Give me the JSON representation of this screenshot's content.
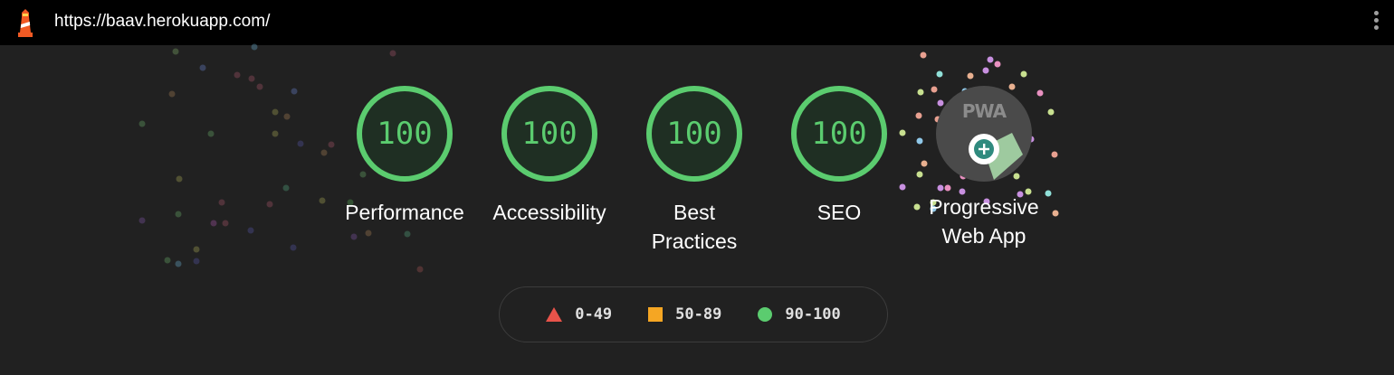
{
  "browser": {
    "url": "https://baav.herokuapp.com/",
    "logo_icon": "lighthouse-icon",
    "menu_icon": "vertical-dots-icon"
  },
  "gauges": [
    {
      "score": "100",
      "label": "Performance"
    },
    {
      "score": "100",
      "label": "Accessibility"
    },
    {
      "score": "100",
      "label_line1": "Best",
      "label_line2": "Practices"
    },
    {
      "score": "100",
      "label": "SEO"
    }
  ],
  "pwa": {
    "badge_text": "PWA",
    "label_line1": "Progressive",
    "label_line2": "Web App",
    "installable_icon": "plus-circle-icon"
  },
  "legend": {
    "fail_range": "0-49",
    "average_range": "50-89",
    "pass_range": "90-100"
  },
  "colors": {
    "background": "#212121",
    "pass": "#5bcc6f",
    "average": "#f5a623",
    "fail": "#e8534a"
  }
}
